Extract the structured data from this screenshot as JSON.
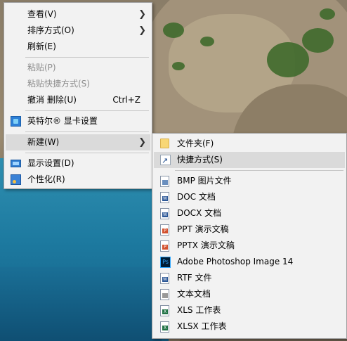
{
  "main_menu": {
    "items": [
      {
        "label": "查看(V)",
        "has_submenu": true
      },
      {
        "label": "排序方式(O)",
        "has_submenu": true
      },
      {
        "label": "刷新(E)"
      },
      {
        "label": "粘贴(P)",
        "disabled": true
      },
      {
        "label": "粘贴快捷方式(S)",
        "disabled": true
      },
      {
        "label": "撤消 删除(U)",
        "shortcut": "Ctrl+Z"
      },
      {
        "label": "英特尔® 显卡设置",
        "icon": "intel-graphics-icon"
      },
      {
        "label": "新建(W)",
        "has_submenu": true,
        "highlighted": true
      },
      {
        "label": "显示设置(D)",
        "icon": "display-settings-icon"
      },
      {
        "label": "个性化(R)",
        "icon": "personalize-icon"
      }
    ]
  },
  "new_submenu": {
    "items": [
      {
        "label": "文件夹(F)",
        "icon": "folder-icon"
      },
      {
        "label": "快捷方式(S)",
        "icon": "shortcut-icon",
        "highlighted": true
      },
      {
        "label": "BMP 图片文件",
        "icon": "bmp-file-icon"
      },
      {
        "label": "DOC 文档",
        "icon": "doc-file-icon"
      },
      {
        "label": "DOCX 文档",
        "icon": "docx-file-icon"
      },
      {
        "label": "PPT 演示文稿",
        "icon": "ppt-file-icon"
      },
      {
        "label": "PPTX 演示文稿",
        "icon": "pptx-file-icon"
      },
      {
        "label": "Adobe Photoshop Image 14",
        "icon": "photoshop-file-icon"
      },
      {
        "label": "RTF 文件",
        "icon": "rtf-file-icon"
      },
      {
        "label": "文本文档",
        "icon": "text-file-icon"
      },
      {
        "label": "XLS 工作表",
        "icon": "xls-file-icon"
      },
      {
        "label": "XLSX 工作表",
        "icon": "xlsx-file-icon"
      }
    ]
  },
  "colors": {
    "menu_bg": "#f2f2f2",
    "highlight": "#dadada",
    "disabled_text": "#8d8d8d"
  }
}
